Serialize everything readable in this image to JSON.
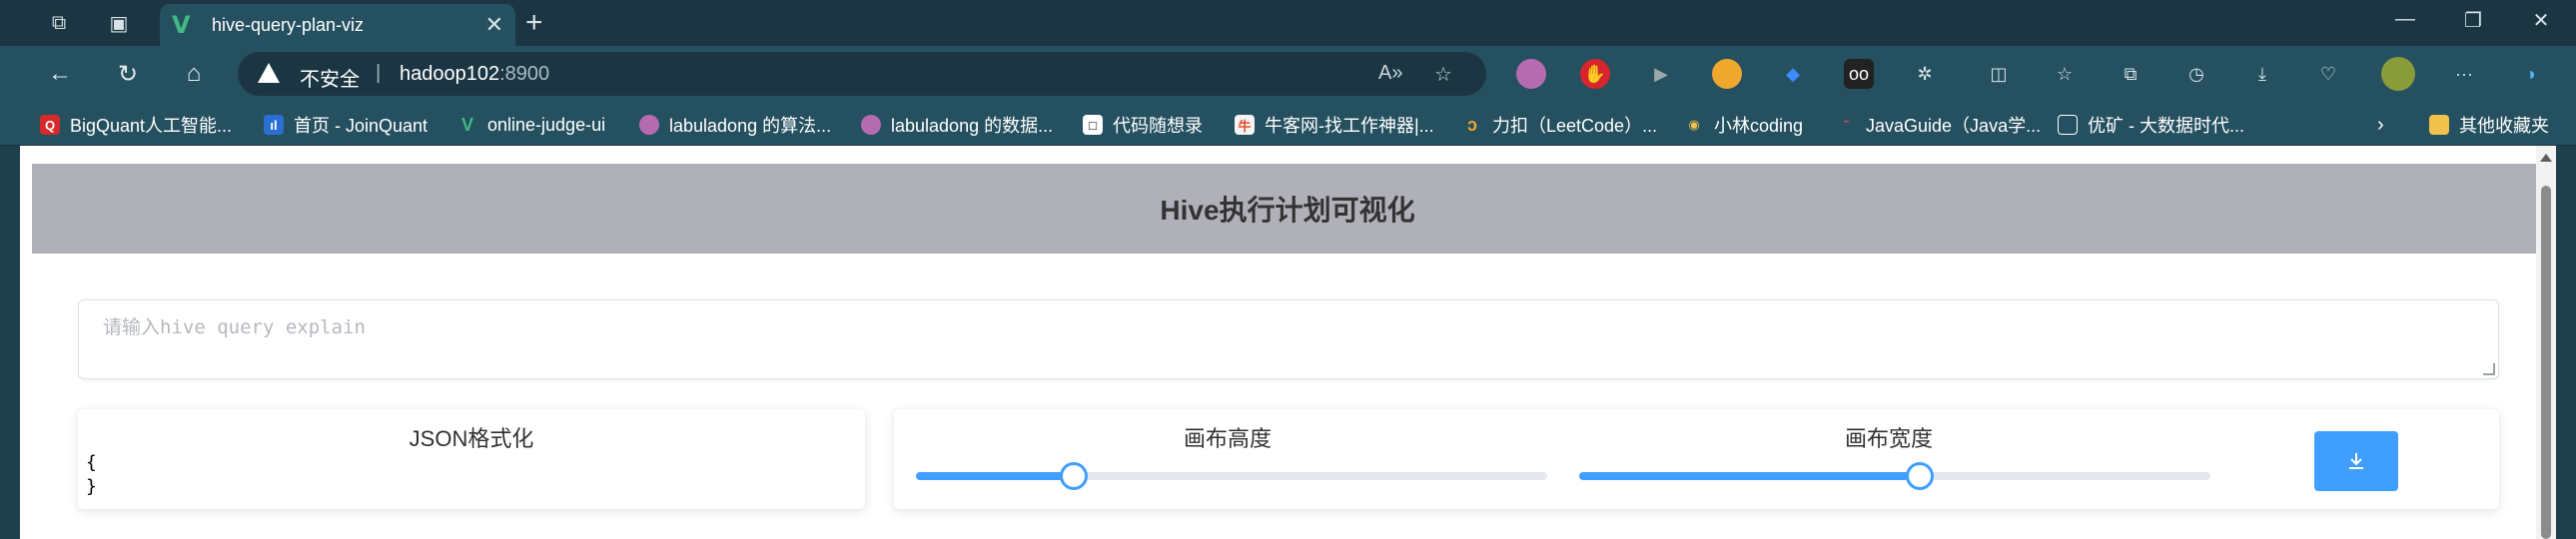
{
  "browser": {
    "tab_title": "hive-query-plan-viz",
    "insecure_label": "不安全",
    "separator": "|",
    "url_host": "hadoop102",
    "url_port": ":8900",
    "bookmarks": [
      "BigQuant人工智能...",
      "首页 - JoinQuant",
      "online-judge-ui",
      "labuladong 的算法...",
      "labuladong 的数据...",
      "代码随想录",
      "牛客网-找工作神器|...",
      "力扣（LeetCode）...",
      "小林coding",
      "JavaGuide（Java学...",
      "优矿 - 大数据时代...",
      "其他收藏夹"
    ],
    "accent": "#42b883"
  },
  "page": {
    "title": "Hive执行计划可视化",
    "query_placeholder": "请输入hive query explain",
    "json_card_title": "JSON格式化",
    "json_line_1": "{",
    "json_line_2": "}",
    "height_label": "画布高度",
    "width_label": "画布宽度",
    "height_slider_value": 0.25,
    "width_slider_value": 0.54,
    "accent_color": "#409eff",
    "header_bg": "#b0b0b8"
  }
}
